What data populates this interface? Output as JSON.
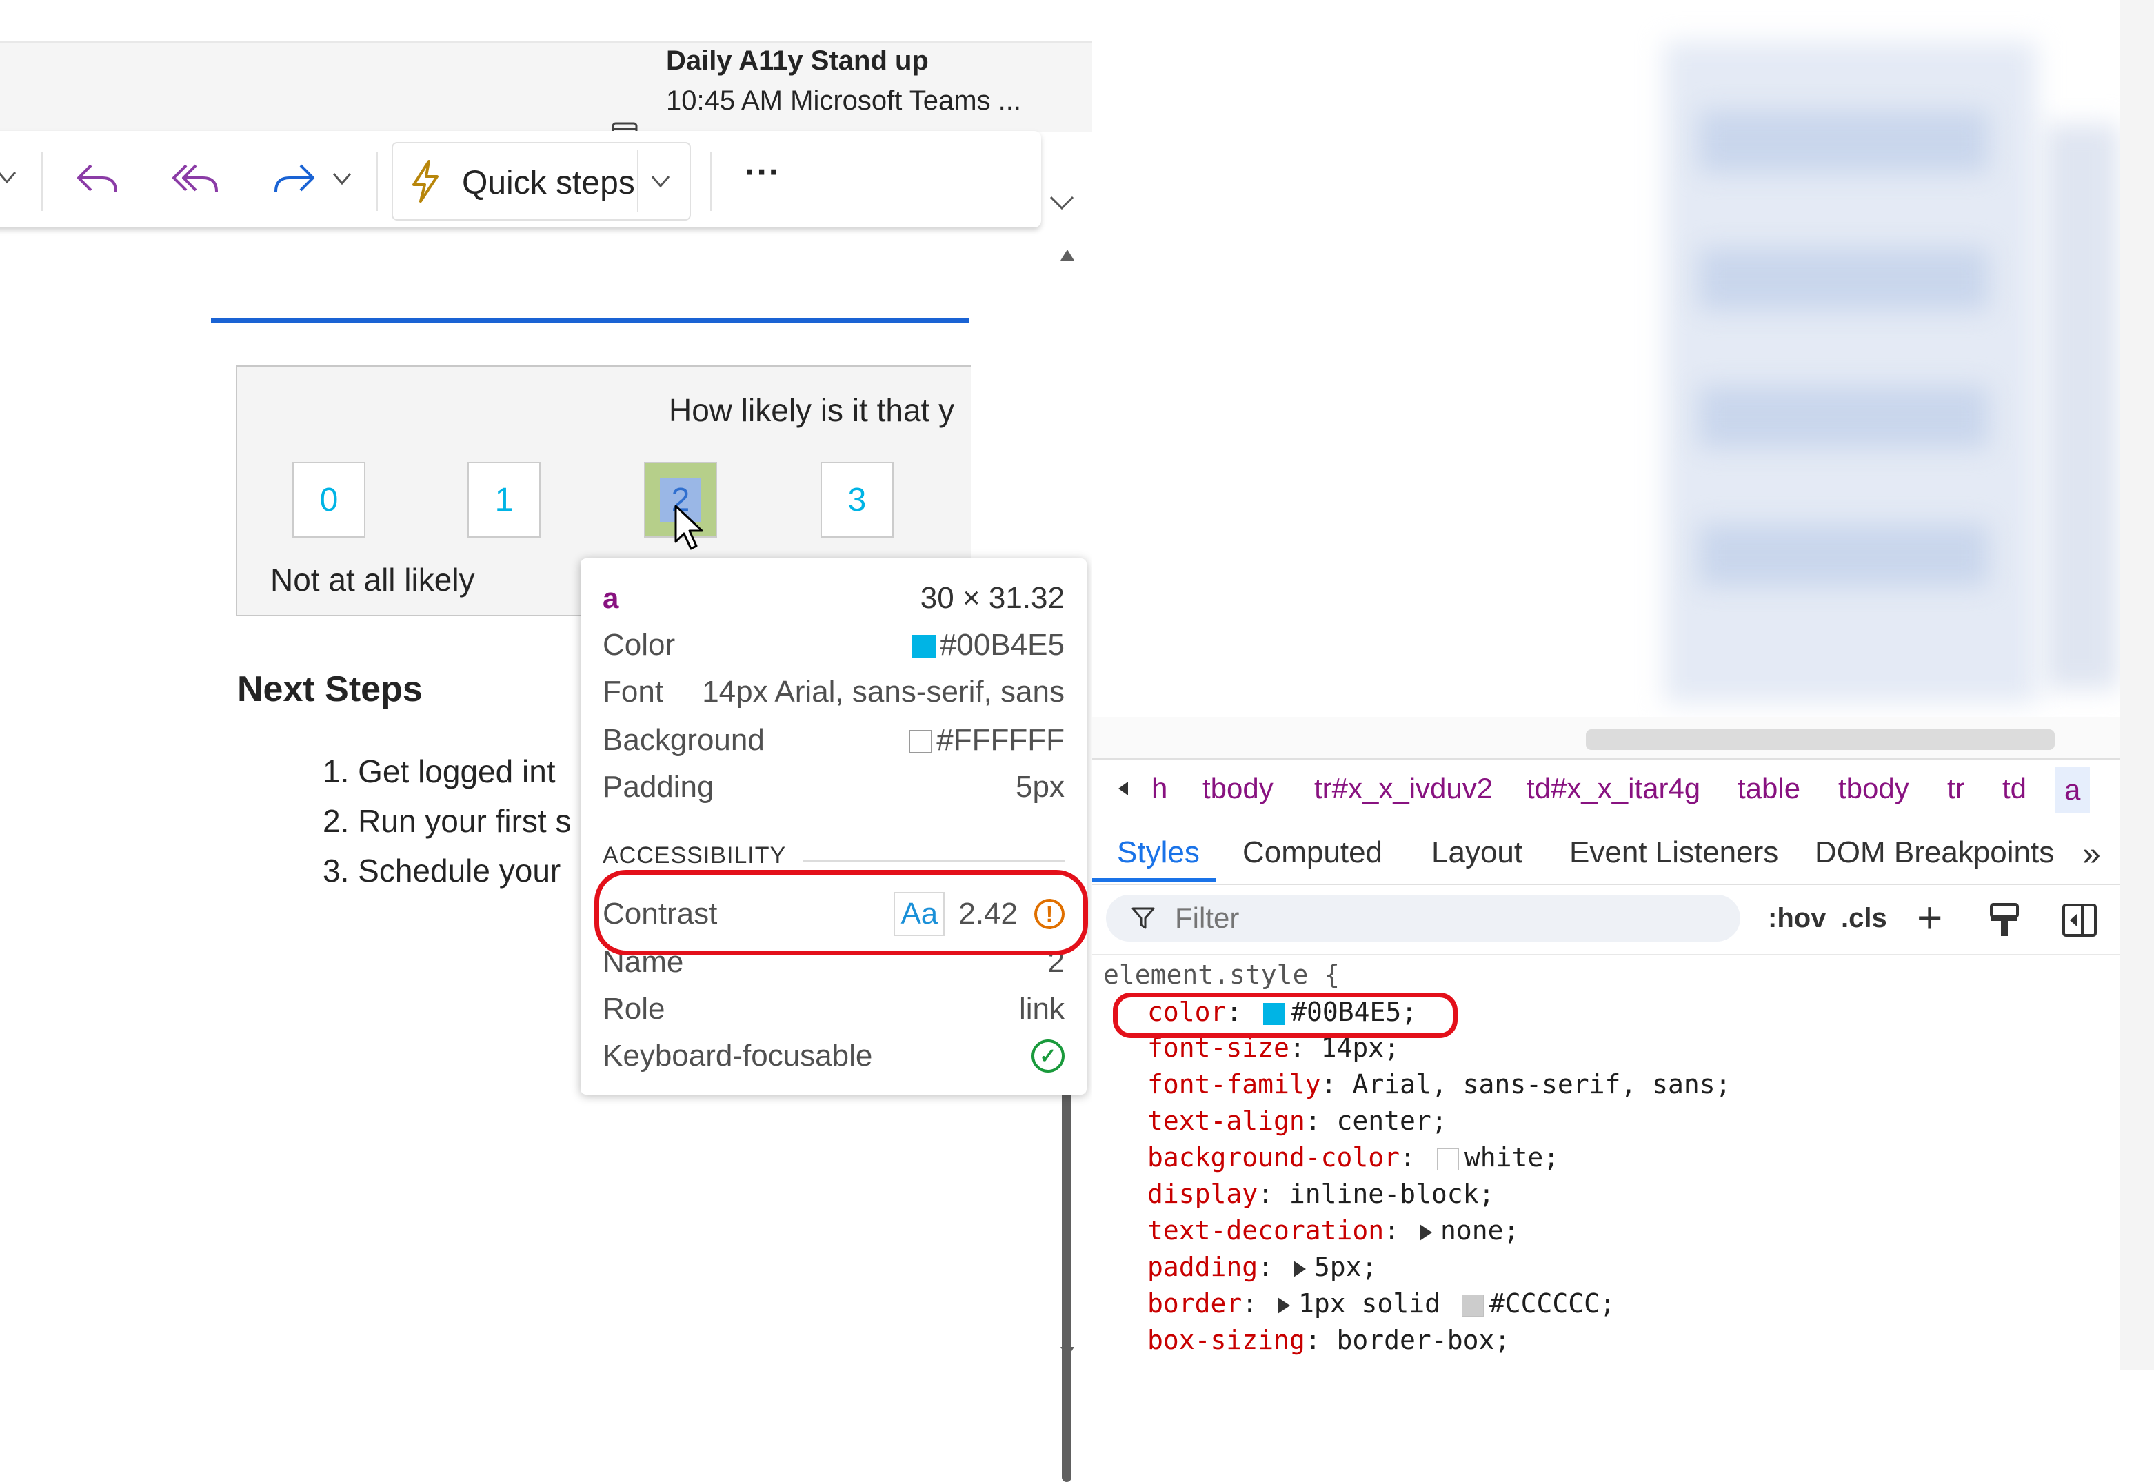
{
  "reminder": {
    "title": "Daily A11y Stand up",
    "subtitle": "10:45 AM Microsoft Teams ..."
  },
  "toolbar": {
    "quick_steps_label": "Quick steps",
    "more_label": "···"
  },
  "email": {
    "survey_question": "How likely is it that y",
    "scores": [
      "0",
      "1",
      "2",
      "3"
    ],
    "not_likely_label": "Not at all likely",
    "next_steps_heading": "Next Steps",
    "steps": [
      "1. Get logged int",
      "2. Run your first s",
      "3. Schedule your"
    ]
  },
  "tooltip": {
    "tag": "a",
    "dimensions": "30 × 31.32",
    "color_label": "Color",
    "color_value": "#00B4E5",
    "font_label": "Font",
    "font_value": "14px Arial, sans-serif, sans",
    "background_label": "Background",
    "background_value": "#FFFFFF",
    "padding_label": "Padding",
    "padding_value": "5px",
    "accessibility_header": "ACCESSIBILITY",
    "contrast_label": "Contrast",
    "contrast_aa": "Aa",
    "contrast_value": "2.42",
    "warn_glyph": "!",
    "name_label": "Name",
    "name_value": "2",
    "role_label": "Role",
    "role_value": "link",
    "focusable_label": "Keyboard-focusable",
    "check_glyph": "✓"
  },
  "devtools": {
    "breadcrumbs": [
      "h",
      "tbody",
      "tr#x_x_ivduv2",
      "td#x_x_itar4g",
      "table",
      "tbody",
      "tr",
      "td",
      "a"
    ],
    "tabs": [
      "Styles",
      "Computed",
      "Layout",
      "Event Listeners",
      "DOM Breakpoints"
    ],
    "tabs_more": "»",
    "filter_placeholder": "Filter",
    "hov": ":hov",
    "cls": ".cls",
    "plus": "+",
    "element_style_selector": "element.style {",
    "declarations": [
      {
        "prop": "color",
        "value": "#00B4E5;"
      },
      {
        "prop": "font-size",
        "value": "14px;"
      },
      {
        "prop": "font-family",
        "value": "Arial, sans-serif, sans;"
      },
      {
        "prop": "text-align",
        "value": "center;"
      },
      {
        "prop": "background-color",
        "value": "white;"
      },
      {
        "prop": "display",
        "value": "inline-block;"
      },
      {
        "prop": "text-decoration",
        "value": "none;"
      },
      {
        "prop": "padding",
        "value": "5px;"
      },
      {
        "prop": "border",
        "value": "1px solid #CCCCCC;"
      },
      {
        "prop": "box-sizing",
        "value": "border-box;"
      }
    ]
  },
  "colors": {
    "link_color": "#00B4E5",
    "background": "#FFFFFF",
    "border_color": "#CCCCCC",
    "highlight_red": "#E3101A",
    "devtools_blue": "#1A73E8",
    "tag_purple": "#881280"
  }
}
